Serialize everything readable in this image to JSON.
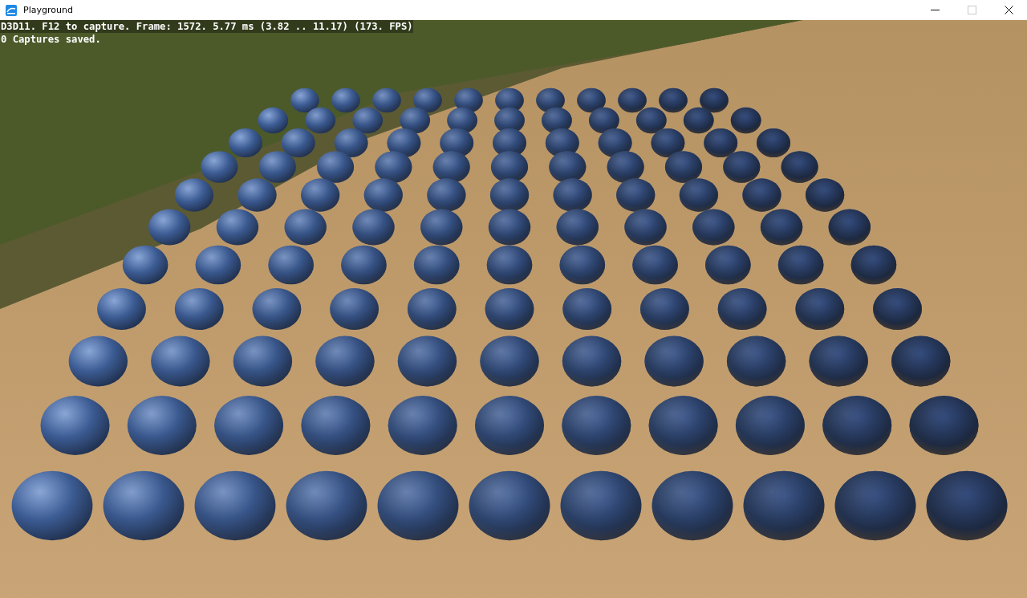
{
  "window": {
    "title": "Playground"
  },
  "controls": [
    {
      "kind": "minimize",
      "disabled": false
    },
    {
      "kind": "maximize",
      "disabled": true
    },
    {
      "kind": "close",
      "disabled": false
    }
  ],
  "overlay": [
    "D3D11. F12 to capture. Frame: 1572. 5.77 ms (3.82 .. 11.17) (173. FPS)",
    "0 Captures saved."
  ]
}
